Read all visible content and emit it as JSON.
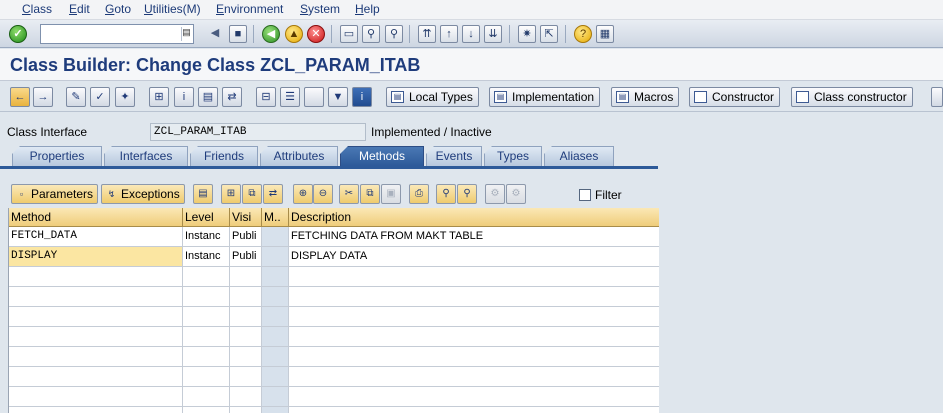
{
  "menu": [
    "Class",
    "Edit",
    "Goto",
    "Utilities(M)",
    "Environment",
    "System",
    "Help"
  ],
  "command_field": {
    "value": ""
  },
  "title": "Class Builder: Change Class ZCL_PARAM_ITAB",
  "app_toolbar": {
    "buttons": [
      "Local Types",
      "Implementation",
      "Macros",
      "Constructor",
      "Class constructor"
    ]
  },
  "header": {
    "class_label": "Class Interface",
    "class_value": "ZCL_PARAM_ITAB",
    "status": "Implemented / Inactive"
  },
  "tabs": [
    "Properties",
    "Interfaces",
    "Friends",
    "Attributes",
    "Methods",
    "Events",
    "Types",
    "Aliases"
  ],
  "active_tab": "Methods",
  "grid_toolbar": {
    "parameters": "Parameters",
    "exceptions": "Exceptions",
    "filter": "Filter"
  },
  "table": {
    "columns": [
      "Method",
      "Level",
      "Visi",
      "M..",
      "Description"
    ],
    "rows": [
      {
        "method": "FETCH_DATA",
        "level": "Instanc",
        "visibility": "Publi",
        "m": "",
        "description": "FETCHING DATA FROM MAKT TABLE"
      },
      {
        "method": "DISPLAY",
        "level": "Instanc",
        "visibility": "Publi",
        "m": "",
        "description": "DISPLAY DATA"
      }
    ]
  },
  "colors": {
    "title": "#1f3c7c",
    "active_tab": "#2d5a99",
    "selected_cell": "#fbe6a2"
  }
}
